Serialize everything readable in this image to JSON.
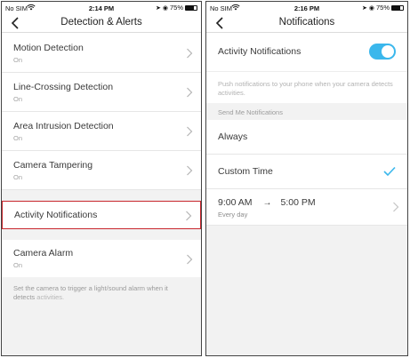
{
  "left_screen": {
    "status": {
      "carrier": "No SIM",
      "time": "2:14 PM",
      "battery": "75%",
      "battery_level": 0.75
    },
    "title": "Detection & Alerts",
    "detections": [
      {
        "label": "Motion Detection",
        "status": "On"
      },
      {
        "label": "Line-Crossing Detection",
        "status": "On"
      },
      {
        "label": "Area Intrusion Detection",
        "status": "On"
      },
      {
        "label": "Camera Tampering",
        "status": "On"
      }
    ],
    "activity_notifications": {
      "label": "Activity Notifications"
    },
    "camera_alarm": {
      "label": "Camera Alarm",
      "status": "On"
    },
    "alarm_hint": "Set the camera to trigger a light/sound alarm when it detects",
    "alarm_hint_accent": "activities."
  },
  "right_screen": {
    "status": {
      "carrier": "No SIM",
      "time": "2:16 PM",
      "battery": "75%",
      "battery_level": 0.75
    },
    "title": "Notifications",
    "activity_notifications": {
      "label": "Activity Notifications",
      "enabled": true
    },
    "push_hint": "Push notifications to your phone when your camera detects activities.",
    "section_header": "Send Me Notifications",
    "options": [
      {
        "label": "Always",
        "selected": false
      },
      {
        "label": "Custom Time",
        "selected": true
      }
    ],
    "schedule": {
      "start": "9:00 AM",
      "arrow": "→",
      "end": "5:00 PM",
      "repeat": "Every day"
    },
    "colors": {
      "accent": "#3ab7ec",
      "highlight_border": "#c8262c"
    }
  }
}
